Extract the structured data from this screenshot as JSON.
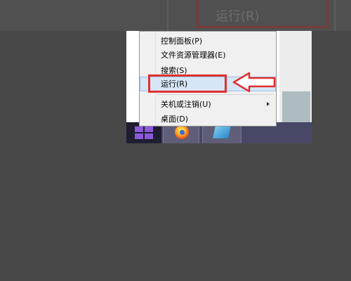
{
  "zoomed_label": "运行(R)",
  "menu": {
    "items": [
      {
        "label": "控制面板(P)"
      },
      {
        "label": "文件资源管理器(E)"
      },
      {
        "label": "搜索(S)"
      },
      {
        "label": "运行(R)",
        "highlighted": true
      },
      {
        "label": "关机或注销(U)",
        "has_submenu": true
      },
      {
        "label": "桌面(D)"
      }
    ]
  },
  "taskbar": {
    "items": [
      {
        "icon": "windows-logo-icon"
      },
      {
        "icon": "firefox-icon"
      },
      {
        "icon": "app-icon"
      }
    ]
  },
  "colors": {
    "annotation": "#e03030",
    "menu_highlight": "#d6e6f6",
    "windows_logo": "#8c5ad8",
    "taskbar": "#474766"
  }
}
